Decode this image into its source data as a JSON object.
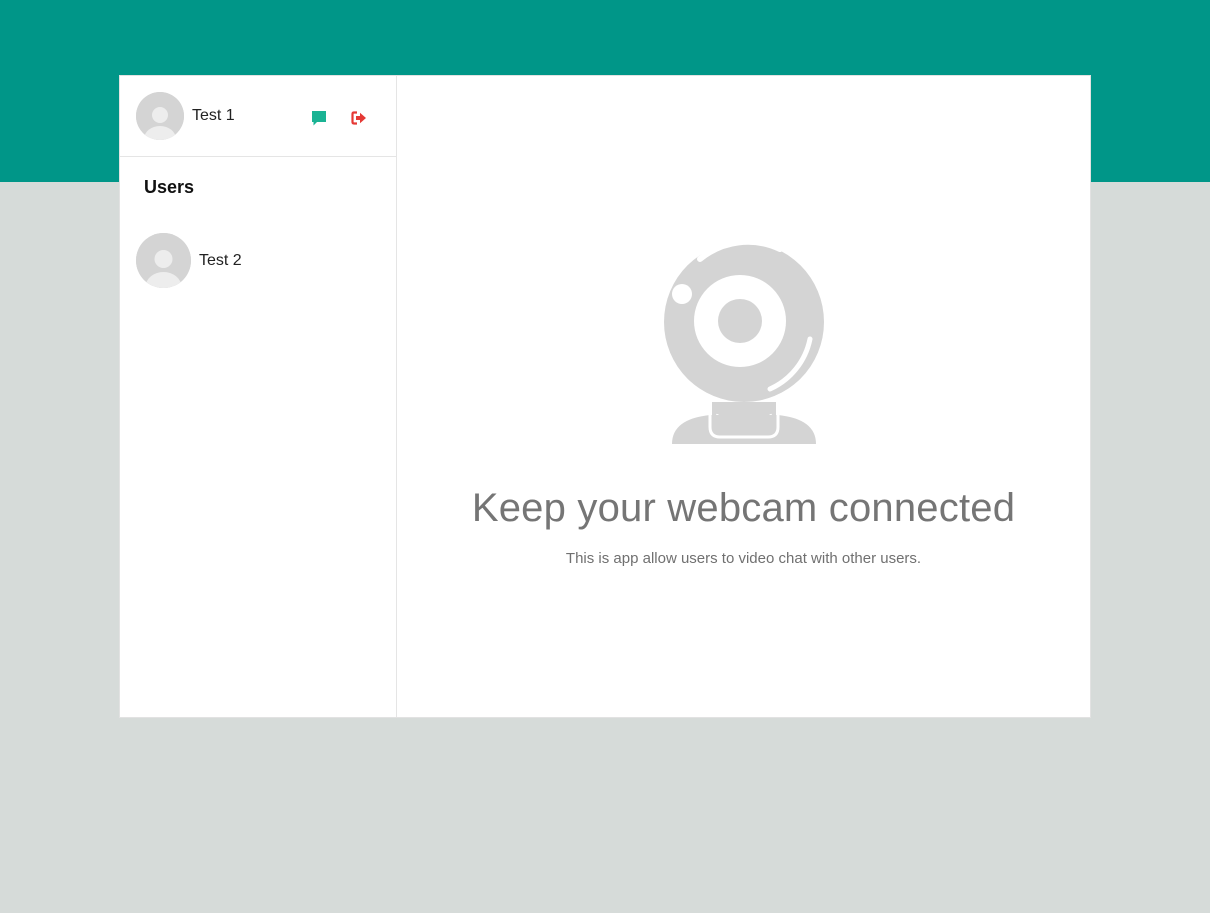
{
  "current_user": {
    "name": "Test 1",
    "avatar_icon": "user-avatar-icon"
  },
  "actions": {
    "chat_icon": "chat-bubble-icon",
    "logout_icon": "sign-out-icon",
    "chat_color": "#1ab394",
    "logout_color": "#e53935"
  },
  "sidebar": {
    "heading": "Users",
    "users": [
      {
        "name": "Test 2",
        "avatar_icon": "user-avatar-icon"
      }
    ]
  },
  "main": {
    "illustration_icon": "webcam-icon",
    "title": "Keep your webcam connected",
    "subtitle": "This is app allow users to video chat with other users."
  },
  "colors": {
    "header_band": "#009688",
    "page_background": "#d6dbd9",
    "placeholder_gray": "#d4d4d4"
  }
}
